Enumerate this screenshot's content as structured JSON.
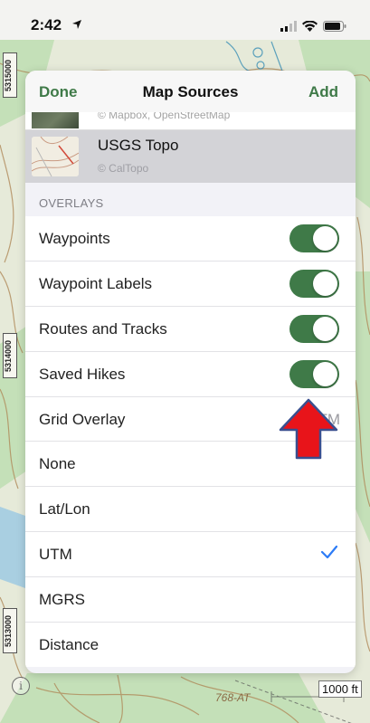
{
  "status_bar": {
    "time": "2:42"
  },
  "map": {
    "coord_labels": [
      "5315000",
      "5314000",
      "5313000"
    ],
    "scale_label": "1000 ft",
    "marker_text": "768-AT",
    "colors": {
      "contour": "#b08a5a",
      "green": "#b8dcae",
      "water": "#a8cde0"
    }
  },
  "sheet": {
    "nav": {
      "done": "Done",
      "title": "Map Sources",
      "add": "Add"
    },
    "partial_source": {
      "attribution": "© Mapbox, OpenStreetMap"
    },
    "selected_source": {
      "name": "USGS Topo",
      "attribution": "© CalTopo"
    },
    "overlays_header": "OVERLAYS",
    "rows": [
      {
        "label": "Waypoints",
        "toggle": true
      },
      {
        "label": "Waypoint Labels",
        "toggle": true
      },
      {
        "label": "Routes and Tracks",
        "toggle": true
      },
      {
        "label": "Saved Hikes",
        "toggle": true
      },
      {
        "label": "Grid Overlay",
        "value": "UTM"
      },
      {
        "label": "None"
      },
      {
        "label": "Lat/Lon"
      },
      {
        "label": "UTM",
        "checked": true
      },
      {
        "label": "MGRS"
      },
      {
        "label": "Distance"
      }
    ],
    "accent_color": "#3f7a48",
    "check_color": "#2d7cf6"
  },
  "annotation": {
    "arrow_color": "#e8141a"
  }
}
